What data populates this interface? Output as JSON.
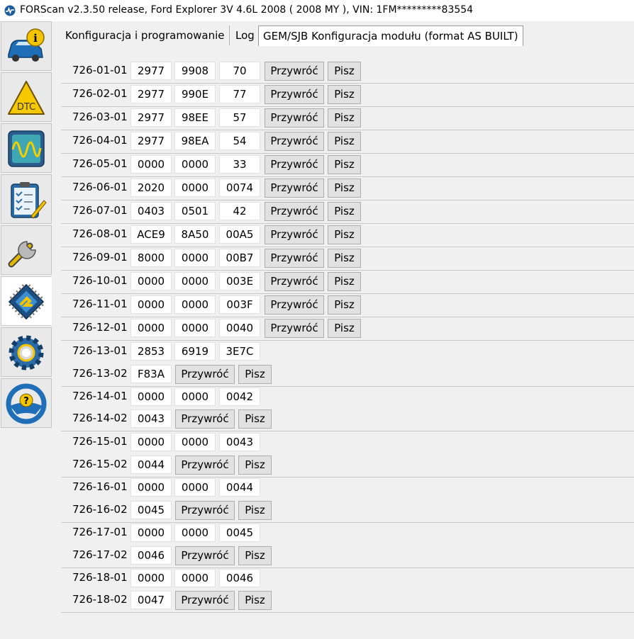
{
  "window": {
    "title": "FORScan v2.3.50 release, Ford Explorer 3V 4.6L 2008 ( 2008 MY ), VIN: 1FM*********83554",
    "app_icon": "forscan-logo-icon"
  },
  "sidebar": {
    "items": [
      {
        "name": "vehicle-info",
        "icon": "car-info-icon"
      },
      {
        "name": "dtc",
        "icon": "dtc-warning-icon"
      },
      {
        "name": "oscilloscope",
        "icon": "oscilloscope-icon"
      },
      {
        "name": "tests",
        "icon": "clipboard-checklist-icon"
      },
      {
        "name": "service",
        "icon": "wrench-icon"
      },
      {
        "name": "configuration",
        "icon": "chip-icon",
        "active": true
      },
      {
        "name": "settings",
        "icon": "gear-icon"
      },
      {
        "name": "help",
        "icon": "steering-wheel-help-icon"
      }
    ]
  },
  "tabs": [
    {
      "label": "Konfiguracja i programowanie"
    },
    {
      "label": "Log"
    },
    {
      "label": "GEM/SJB Konfiguracja modułu (format AS BUILT)",
      "active": true
    }
  ],
  "buttons": {
    "restore": "Przywróć",
    "write": "Pisz"
  },
  "rows": [
    {
      "addr": "726-01-01",
      "fields": [
        "2977",
        "9908",
        "70"
      ]
    },
    {
      "addr": "726-02-01",
      "fields": [
        "2977",
        "990E",
        "77"
      ]
    },
    {
      "addr": "726-03-01",
      "fields": [
        "2977",
        "98EE",
        "57"
      ]
    },
    {
      "addr": "726-04-01",
      "fields": [
        "2977",
        "98EA",
        "54"
      ]
    },
    {
      "addr": "726-05-01",
      "fields": [
        "0000",
        "0000",
        "33"
      ]
    },
    {
      "addr": "726-06-01",
      "fields": [
        "2020",
        "0000",
        "0074"
      ]
    },
    {
      "addr": "726-07-01",
      "fields": [
        "0403",
        "0501",
        "42"
      ]
    },
    {
      "addr": "726-08-01",
      "fields": [
        "ACE9",
        "8A50",
        "00A5"
      ]
    },
    {
      "addr": "726-09-01",
      "fields": [
        "8000",
        "0000",
        "00B7"
      ]
    },
    {
      "addr": "726-10-01",
      "fields": [
        "0000",
        "0000",
        "003E"
      ]
    },
    {
      "addr": "726-11-01",
      "fields": [
        "0000",
        "0000",
        "003F"
      ]
    },
    {
      "addr": "726-12-01",
      "fields": [
        "0000",
        "0000",
        "0040"
      ]
    },
    {
      "addr": "726-13-01",
      "fields": [
        "2853",
        "6919",
        "3E7C"
      ]
    },
    {
      "addr": "726-13-02",
      "fields": [
        "F83A"
      ]
    },
    {
      "addr": "726-14-01",
      "fields": [
        "0000",
        "0000",
        "0042"
      ]
    },
    {
      "addr": "726-14-02",
      "fields": [
        "0043"
      ]
    },
    {
      "addr": "726-15-01",
      "fields": [
        "0000",
        "0000",
        "0043"
      ]
    },
    {
      "addr": "726-15-02",
      "fields": [
        "0044"
      ]
    },
    {
      "addr": "726-16-01",
      "fields": [
        "0000",
        "0000",
        "0044"
      ]
    },
    {
      "addr": "726-16-02",
      "fields": [
        "0045"
      ]
    },
    {
      "addr": "726-17-01",
      "fields": [
        "0000",
        "0000",
        "0045"
      ]
    },
    {
      "addr": "726-17-02",
      "fields": [
        "0046"
      ]
    },
    {
      "addr": "726-18-01",
      "fields": [
        "0000",
        "0000",
        "0046"
      ]
    },
    {
      "addr": "726-18-02",
      "fields": [
        "0047"
      ]
    }
  ]
}
